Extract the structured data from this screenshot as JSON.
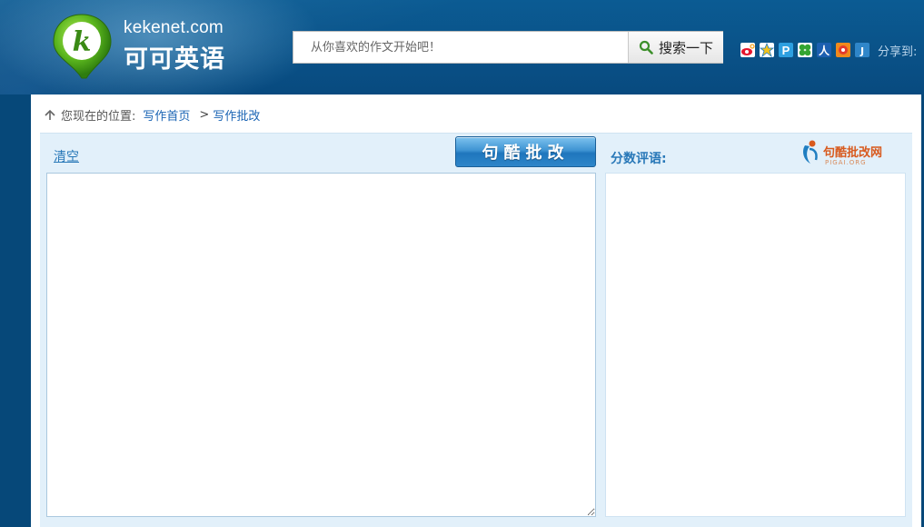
{
  "header": {
    "logo_en": "kekenet.com",
    "logo_cn": "可可英语",
    "search_placeholder": "从你喜欢的作文开始吧！",
    "search_button": "搜索一下",
    "share_label": "分享到:",
    "share_icons": [
      "weibo-icon",
      "qzone-icon",
      "tencent-weibo-icon",
      "kaixin-icon",
      "renren-icon",
      "douban-icon",
      "more-share-icon"
    ]
  },
  "breadcrumb": {
    "prefix": "您现在的位置:",
    "home": "写作首页",
    "separator": ">",
    "current": "写作批改"
  },
  "editor": {
    "clear_label": "清空",
    "submit_label": "句酷批改"
  },
  "score": {
    "label": "分数评语:",
    "brand_cn": "句酷批改网",
    "brand_en": "PIGAI.ORG"
  },
  "colors": {
    "header_bg": "#0a5288",
    "panel_bg": "#e2f0fa",
    "link": "#1a64b4",
    "accent_orange": "#d85a1e"
  }
}
